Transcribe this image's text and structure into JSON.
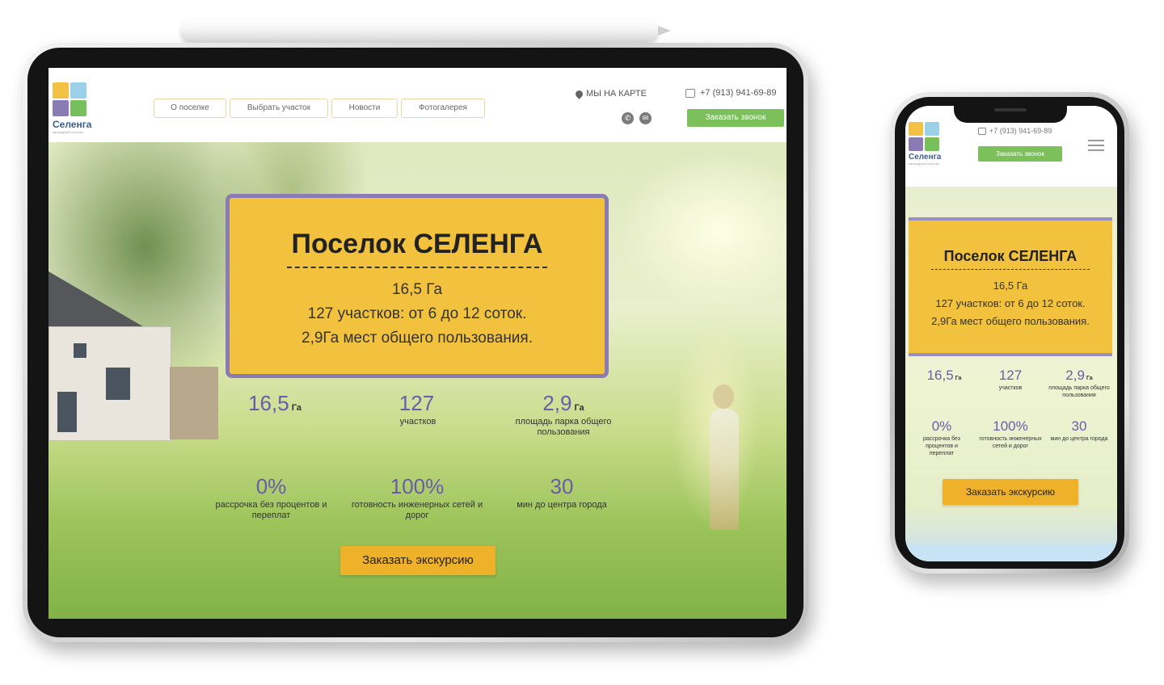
{
  "brand": {
    "name": "Селенга",
    "tagline": "загородный посёлок",
    "logo_colors": [
      "#f3c244",
      "#9ad0e8",
      "#8a7cb2",
      "#76bf5b"
    ]
  },
  "header": {
    "nav": [
      "О поселке",
      "Выбрать участок",
      "Новости",
      "Фотогалерея"
    ],
    "map_link": "МЫ НА КАРТЕ",
    "phone": "+7 (913) 941-69-89",
    "callback_button": "Заказать звонок"
  },
  "hero": {
    "title": "Поселок СЕЛЕНГА",
    "lines": [
      "16,5 Га",
      "127 участков: от 6 до 12 соток.",
      "2,9Га мест общего пользования."
    ],
    "stats": [
      {
        "value": "16,5",
        "unit": "Га",
        "label": ""
      },
      {
        "value": "127",
        "unit": "",
        "label": "участков"
      },
      {
        "value": "2,9",
        "unit": "Га",
        "label": "площадь парка общего пользования"
      },
      {
        "value": "0%",
        "unit": "",
        "label": "рассрочка без процентов и переплат"
      },
      {
        "value": "100%",
        "unit": "",
        "label": "готовность инженерных сетей и дорог"
      },
      {
        "value": "30",
        "unit": "",
        "label": "мин до центра города"
      }
    ],
    "cta": "Заказать экскурсию"
  },
  "colors": {
    "accent_yellow": "#f2c13d",
    "accent_purple": "#8a7cb2",
    "number_purple": "#6a5ca8",
    "button_green": "#7cc05b",
    "button_orange": "#efb02a"
  },
  "icons": [
    "location-pin-icon",
    "phone-icon",
    "viber-icon",
    "whatsapp-icon",
    "burger-menu-icon"
  ]
}
